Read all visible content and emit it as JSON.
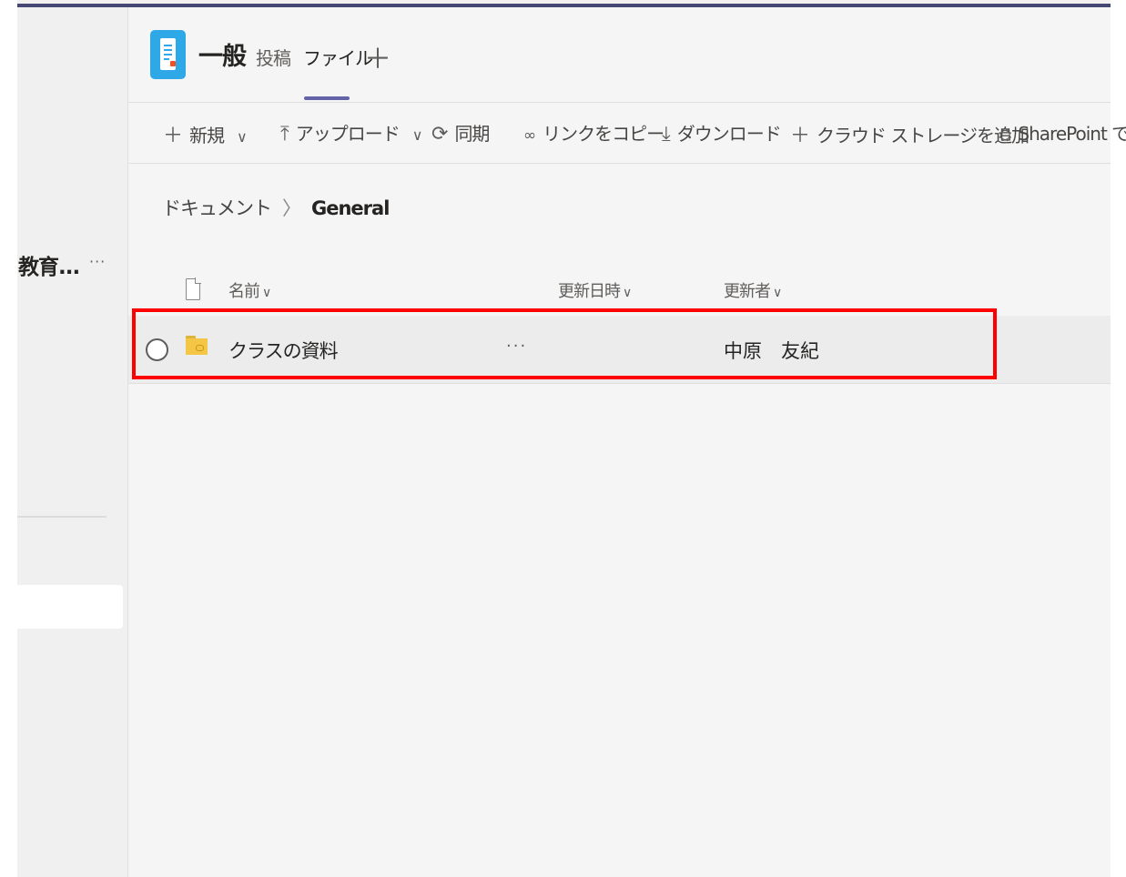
{
  "sidebar": {
    "team_name": "教育...",
    "more": "···"
  },
  "channel": {
    "title": "一般",
    "tabs": [
      {
        "label": "投稿"
      },
      {
        "label": "ファイル"
      }
    ],
    "add_tab": "＋",
    "icon": "channel-doc-icon"
  },
  "toolbar": {
    "new": "新規",
    "upload": "アップロード",
    "sync": "同期",
    "copy_link": "リンクをコピー",
    "download": "ダウンロード",
    "add_cloud_storage": "クラウド ストレージを追加",
    "sharepoint": "SharePoint で"
  },
  "breadcrumb": {
    "root": "ドキュメント",
    "current": "General"
  },
  "columns": {
    "name": "名前",
    "modified": "更新日時",
    "modified_by": "更新者"
  },
  "files": [
    {
      "name": "クラスの資料",
      "more": "···",
      "modified": "",
      "modified_by": "中原　友紀",
      "type": "shared-folder"
    }
  ],
  "colors": {
    "accent": "#6264a7",
    "highlight": "#ff0000",
    "topbar": "#464775"
  }
}
